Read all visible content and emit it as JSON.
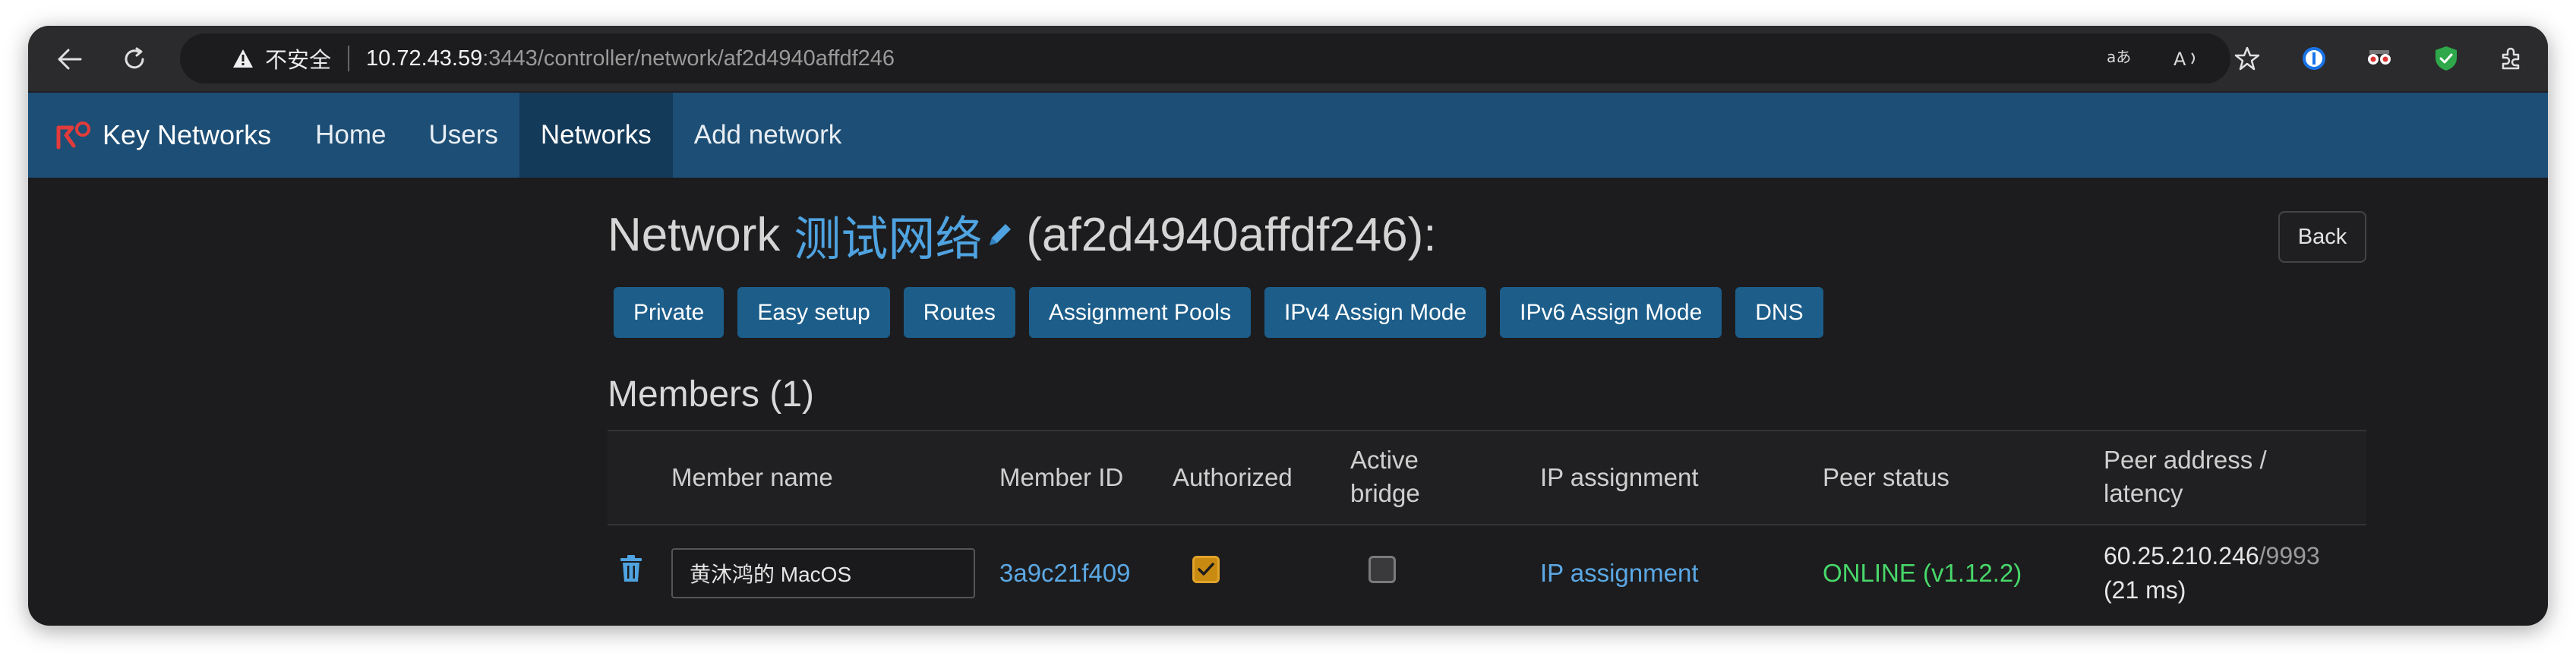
{
  "browser": {
    "address": {
      "insecure_label": "不安全",
      "host": "10.72.43.59",
      "path": ":3443/controller/network/af2d4940affdf246"
    },
    "icons": [
      "back-arrow-icon",
      "reload-icon",
      "warning-icon",
      "translate-icon",
      "read-aloud-icon",
      "star-icon",
      "onepassword-icon",
      "extension-icon",
      "shield-icon",
      "puzzle-icon"
    ]
  },
  "navbar": {
    "brand": "Key Networks",
    "items": [
      {
        "label": "Home"
      },
      {
        "label": "Users"
      },
      {
        "label": "Networks",
        "active": true
      },
      {
        "label": "Add network"
      }
    ],
    "color": "#1d4e75"
  },
  "page": {
    "title_prefix": "Network",
    "network_name": "测试网络",
    "network_id": "(af2d4940affdf246):",
    "back_label": "Back",
    "buttons": [
      {
        "label": "Private"
      },
      {
        "label": "Easy setup"
      },
      {
        "label": "Routes"
      },
      {
        "label": "Assignment Pools"
      },
      {
        "label": "IPv4 Assign Mode"
      },
      {
        "label": "IPv6 Assign Mode"
      },
      {
        "label": "DNS"
      }
    ],
    "members_title": "Members (1)"
  },
  "members_table": {
    "headers": {
      "member_name": "Member name",
      "member_id": "Member ID",
      "authorized": "Authorized",
      "active_bridge_1": "Active",
      "active_bridge_2": "bridge",
      "ip_assignment": "IP assignment",
      "peer_status": "Peer status",
      "peer_address_1": "Peer address /",
      "peer_address_2": "latency"
    },
    "rows": [
      {
        "member_name": "黄沐鸿的 MacOS",
        "member_id": "3a9c21f409",
        "authorized": true,
        "active_bridge": false,
        "ip_assignment": "IP assignment",
        "peer_status": "ONLINE (v1.12.2)",
        "peer_address": "60.25.210.246",
        "peer_port": "/9993",
        "latency": "(21 ms)"
      }
    ]
  },
  "colors": {
    "link": "#5ba8e4",
    "online": "#48d86a",
    "button": "#1c5d8a"
  }
}
